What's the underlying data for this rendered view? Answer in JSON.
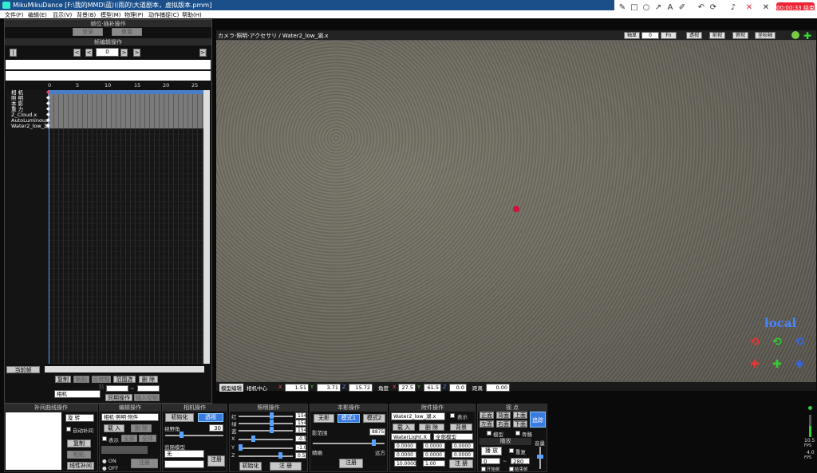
{
  "title": "MikuMikuDance [F:\\我的MMD\\蓝川雨的\\大道剧本，虚拟版本.pmm]",
  "recorder": {
    "timer": "00:00:33 结束"
  },
  "menu": [
    "文件(F)",
    "编辑(E)",
    "显示(V)",
    "背景(B)",
    "模型(M)",
    "物理(P)",
    "动作捕捉(C)",
    "帮助(H)"
  ],
  "left_panel": {
    "header": "帧位·插补操作",
    "btn_register": "登录",
    "btn_reset": "重置",
    "frame_header": "帧编辑操作",
    "frame_value": "0",
    "ruler": [
      "0",
      "5",
      "10",
      "15",
      "20",
      "25"
    ],
    "tracks": [
      "相  机",
      "照  明",
      "本  影",
      "重  力",
      "Z_Cloud.x",
      "AutoLuminous",
      "Water2_low_湖"
    ],
    "btn_current": "当前帧",
    "btn_copy": "复制",
    "btn_paste": "粘贴",
    "btn_reverse": "反转粘贴",
    "btn_range": "范围选择",
    "btn_delete": "删 除",
    "select_value": "相机",
    "btn_sync": "同期操作",
    "btn_insert": "插入空帧",
    "range_separator": "~"
  },
  "viewport": {
    "tab": "カメラ·照明·アクセサリ / Water2_low_湖.x",
    "btn_axis": "轴显",
    "field_value": "0",
    "btn_fov": "Fn",
    "btn_persp": "透视",
    "btn_front": "前视",
    "btn_top": "俯视",
    "btn_coord": "坐标轴",
    "mode_label": "local"
  },
  "statusbar": {
    "tab": "模型编辑",
    "label_center": "相机中心",
    "x_label": "X",
    "x": "1.51",
    "y_label": "Y",
    "y": "3.71",
    "z_label": "Z",
    "z": "15.72",
    "angle_label": "角度",
    "ax": "27.5",
    "ay": "61.5",
    "az": "0.0",
    "dist_label": "距离",
    "dist": "0.00"
  },
  "bottom": {
    "interp_header": "补间曲线操作",
    "interp_select": "旋 转",
    "interp_auto": "自动补间",
    "interp_copy": "复制",
    "interp_paste": "粘贴",
    "interp_calc": "线性补间",
    "interp_on": "ON",
    "interp_off": "OFF",
    "edit_header": "编辑操作",
    "edit_select": "相机·照明·附件",
    "edit_load": "载 入",
    "edit_delete": "删 除",
    "edit_show": "表示",
    "edit_all": "全部",
    "edit_all2": "全体",
    "edit_register": "注册",
    "camera_header": "相机操作",
    "camera_init": "初始化",
    "camera_persp": "透视",
    "camera_fov_label": "视野角",
    "camera_fov": "30",
    "camera_follow_label": "追随模型",
    "camera_follow": "无",
    "camera_register": "注册",
    "light_header": "照明操作",
    "light_labels": [
      "红",
      "绿",
      "蓝",
      "X",
      "Y",
      "Z"
    ],
    "light_values": [
      "154",
      "154",
      "154",
      "-0.5",
      "-1.0",
      "0.5"
    ],
    "light_init": "初始化",
    "light_register": "注 册",
    "shadow_header": "本影操作",
    "shadow_none": "无影",
    "shadow_mode1": "模式1",
    "shadow_mode2": "模式2",
    "shadow_range_label": "影范围",
    "shadow_range": "8875",
    "shadow_near": "精确",
    "shadow_far": "远方",
    "shadow_register": "注册",
    "acc_header": "附件操作",
    "acc_select": "Water2_low_湖.x",
    "acc_show": "表示",
    "acc_load": "载 入",
    "acc_delete": "删 除",
    "acc_cs": "背景",
    "acc_bone_select": "WaterLight.X",
    "acc_parent_select": "全部模型",
    "acc_x": "0.0000",
    "acc_y": "0.0000",
    "acc_z": "0.0000",
    "acc_rx": "0.0000",
    "acc_ry": "0.0000",
    "acc_rz": "0.0000",
    "acc_si": "10.0000",
    "acc_tr": "1.00",
    "acc_register": "注 册",
    "view_header": "视 点",
    "view_front": "正面",
    "view_back": "背面",
    "view_top": "上面",
    "view_left": "左面",
    "view_right": "右面",
    "view_bottom": "下面",
    "view_model": "追踪",
    "view_model2": "模型",
    "view_bone": "骨骼",
    "play_header": "播放",
    "play_btn": "播 放",
    "play_repeat": "重复",
    "play_from": "0",
    "play_to": "280",
    "play_sep": "~",
    "play_start": "开始帧",
    "play_end": "结束帧",
    "volume_header": "音量",
    "fps1": "10.5",
    "fps_unit1": "FPS",
    "fps2": "4.0",
    "fps_unit2": "FPS"
  }
}
